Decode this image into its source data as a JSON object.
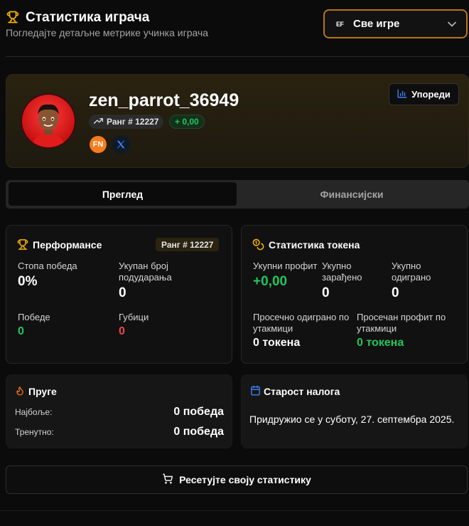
{
  "header": {
    "title": "Статистика играча",
    "subtitle": "Погледајте детаљне метрике учинка играча",
    "game_select": {
      "logo": "EF",
      "value": "Све игре"
    }
  },
  "profile": {
    "username": "zen_parrot_36949",
    "rank": "Ранг # 12227",
    "profit": "+ 0,00",
    "social": {
      "fn_label": "FN"
    },
    "compare_label": "Упореди"
  },
  "tabs": [
    {
      "label": "Преглед",
      "active": true
    },
    {
      "label": "Финансијски",
      "active": false
    }
  ],
  "performance": {
    "title": "Перформансе",
    "rank_badge": "Ранг # 12227",
    "win_rate_label": "Стопа победа",
    "win_rate_value": "0%",
    "total_matches_label": "Укупан број подударања",
    "total_matches_value": "0",
    "wins_label": "Победе",
    "wins_value": "0",
    "losses_label": "Губици",
    "losses_value": "0"
  },
  "tokens": {
    "title": "Статистика токена",
    "total_profit_label": "Укупни профит",
    "total_profit_value": "+0,00",
    "total_earned_label": "Укупно зарађено",
    "total_earned_value": "0",
    "total_played_label": "Укупно одиграно",
    "total_played_value": "0",
    "avg_played_label": "Просечно одиграно по утакмици",
    "avg_played_value": "0 токена",
    "avg_profit_label": "Просечан профит по утакмици",
    "avg_profit_value": "0 токена"
  },
  "streaks": {
    "title": "Пруге",
    "best_label": "Најбоље:",
    "best_value": "0 победа",
    "current_label": "Тренутно:",
    "current_value": "0 победа"
  },
  "account_age": {
    "title": "Старост налога",
    "text": "Придружио се у суботу, 27. септембра 2025."
  },
  "reset_label": "Ресетујте своју статистику",
  "colors": {
    "accent": "#b8741a",
    "positive": "#22c55e",
    "negative": "#ef4444",
    "background": "#0b0b0b",
    "card": "#111111"
  },
  "icons": {
    "title": "trophy-icon",
    "select_chevron": "chevron-down-icon",
    "compare": "bar-chart-icon",
    "rank": "trending-up-icon",
    "tokens": "coins-icon",
    "streaks": "flame-icon",
    "account_age": "calendar-icon",
    "reset": "cart-icon",
    "social_x": "x-logo-icon"
  }
}
